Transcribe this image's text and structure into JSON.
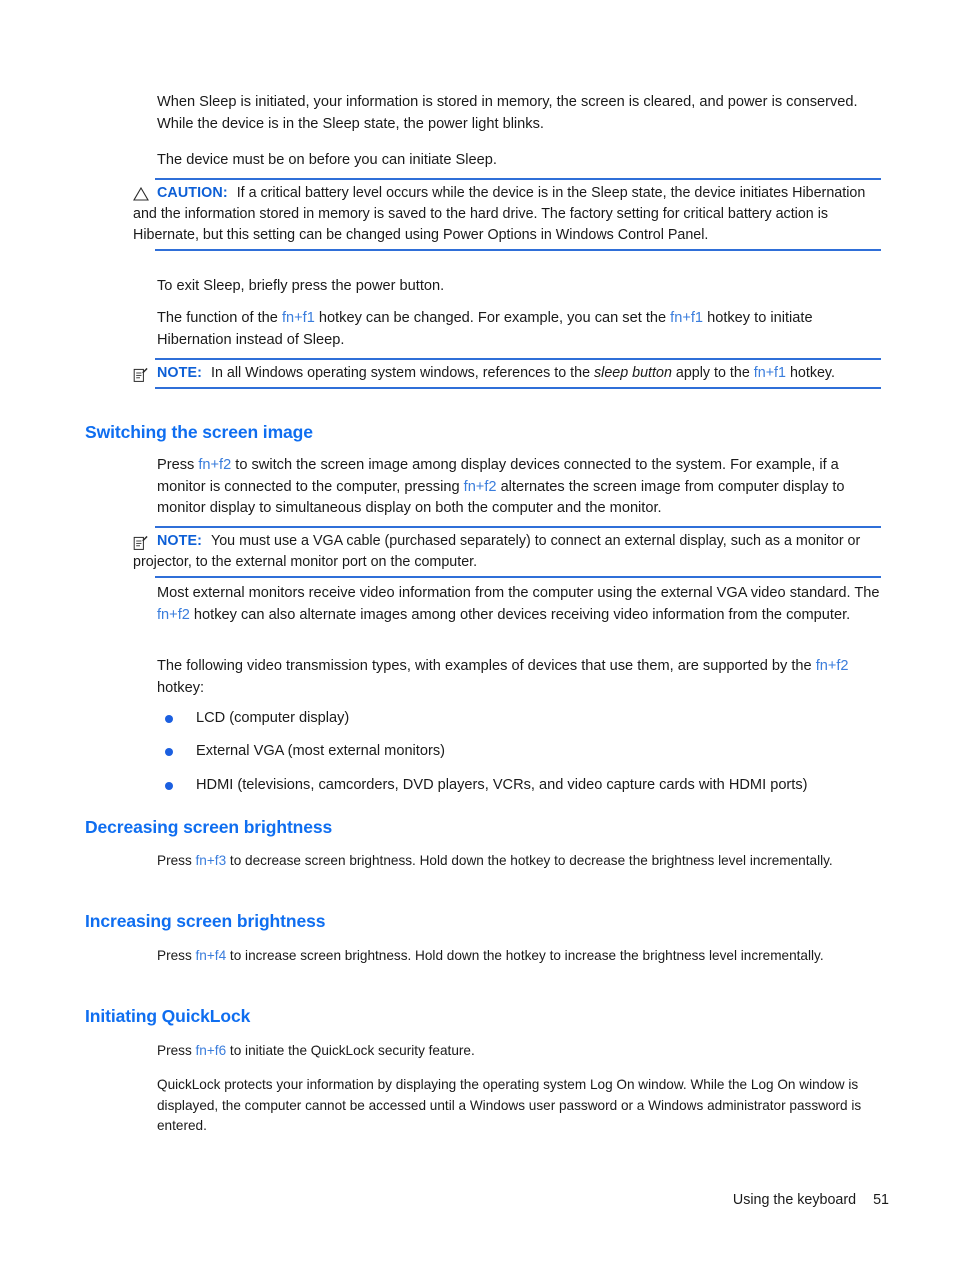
{
  "document": {
    "intro_paragraphs": [
      "When Sleep is initiated, your information is stored in memory, the screen is cleared, and power is conserved. While the device is in the Sleep state, the power light blinks.",
      "The device must be on before you can initiate Sleep."
    ],
    "caution": {
      "icon": "warning-triangle-icon",
      "label": "CAUTION:",
      "text": "If a critical battery level occurs while the device is in the Sleep state, the device initiates Hibernation and the information stored in memory is saved to the hard drive. The factory setting for critical battery action is Hibernate, but this setting can be changed using Power Options in Windows Control Panel."
    },
    "exit_sleep_paragraph": "To exit Sleep, briefly press the power button.",
    "fn_f1_paragraph": {
      "before": "The function of the ",
      "key1": "fn+f1",
      "middle": " hotkey can be changed. For example, you can set the ",
      "key2": "fn+f1",
      "after": " hotkey to initiate Hibernation instead of Sleep."
    },
    "note_sleep_button": {
      "icon": "note-document-icon",
      "label": "NOTE:",
      "before": "In all Windows operating system windows, references to the ",
      "italic": "sleep button",
      "middle": " apply to the ",
      "key": "fn+f1",
      "after": " hotkey."
    },
    "sections": [
      {
        "id": "switching-the-screen-image",
        "heading": "Switching the screen image",
        "intro": {
          "before": "Press ",
          "key1": "fn+f2",
          "middle": " to switch the screen image among display devices connected to the system. For example, if a monitor is connected to the computer, pressing ",
          "key2": "fn+f2",
          "after": " alternates the screen image from computer display to monitor display to simultaneous display on both the computer and the monitor."
        },
        "note": {
          "icon": "note-document-icon",
          "label": "NOTE:",
          "text": "You must use a VGA cable (purchased separately) to connect an external display, such as a monitor or projector, to the external monitor port on the computer."
        },
        "paragraph_vga": {
          "before": "Most external monitors receive video information from the computer using the external VGA video standard. The ",
          "key": "fn+f2",
          "after": " hotkey can also alternate images among other devices receiving video information from the computer."
        },
        "paragraph_types": {
          "before": "The following video transmission types, with examples of devices that use them, are supported by the ",
          "key": "fn+f2",
          "after": " hotkey:"
        },
        "bullets": [
          "LCD (computer display)",
          "External VGA (most external monitors)",
          "HDMI (televisions, camcorders, DVD players, VCRs, and video capture cards with HDMI ports)"
        ]
      },
      {
        "id": "decreasing-screen-brightness",
        "heading": "Decreasing screen brightness",
        "paragraph": {
          "before": "Press ",
          "key": "fn+f3",
          "after": " to decrease screen brightness. Hold down the hotkey to decrease the brightness level incrementally."
        }
      },
      {
        "id": "increasing-screen-brightness",
        "heading": "Increasing screen brightness",
        "paragraph": {
          "before": "Press ",
          "key": "fn+f4",
          "after": " to increase screen brightness. Hold down the hotkey to increase the brightness level incrementally."
        }
      },
      {
        "id": "initiating-quicklock",
        "heading": "Initiating QuickLock",
        "paragraph": {
          "before": "Press ",
          "key": "fn+f6",
          "after": " to initiate the QuickLock security feature."
        },
        "paragraph_2": "QuickLock protects your information by displaying the operating system Log On window. While the Log On window is displayed, the computer cannot be accessed until a Windows user password or a Windows administrator password is entered."
      }
    ],
    "footer": {
      "section_title": "Using the keyboard",
      "page_number": "51"
    },
    "colors": {
      "heading_blue": "#0f6ef0",
      "admon_label_blue": "#0d5fd6",
      "rule_blue": "#2f6fd8",
      "key_blue": "#3a7ddc",
      "bullet_blue": "#1b5fe0",
      "body_text": "#1a1a1a"
    }
  }
}
